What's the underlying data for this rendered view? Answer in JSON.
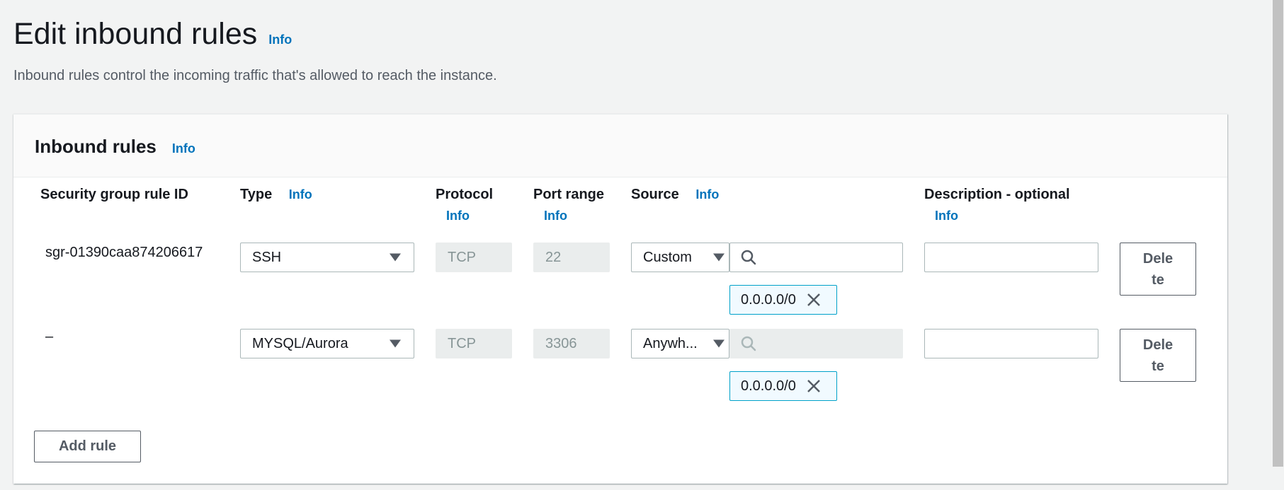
{
  "page": {
    "title": "Edit inbound rules",
    "title_info": "Info",
    "description": "Inbound rules control the incoming traffic that's allowed to reach the instance."
  },
  "panel": {
    "title": "Inbound rules",
    "title_info": "Info",
    "columns": {
      "rule_id": "Security group rule ID",
      "type": "Type",
      "type_info": "Info",
      "protocol": "Protocol",
      "protocol_info": "Info",
      "port_range": "Port range",
      "port_range_info": "Info",
      "source": "Source",
      "source_info": "Info",
      "description": "Description - optional",
      "description_info": "Info"
    },
    "rules": [
      {
        "rule_id": "sgr-01390caa874206617",
        "type": "SSH",
        "protocol": "TCP",
        "port_range": "22",
        "source_type": "Custom",
        "source_search": "",
        "source_search_disabled": false,
        "cidr_token": "0.0.0.0/0",
        "description": "",
        "delete_label": "Delete"
      },
      {
        "rule_id": "–",
        "type": "MYSQL/Aurora",
        "protocol": "TCP",
        "port_range": "3306",
        "source_type": "Anywh...",
        "source_search": "",
        "source_search_disabled": true,
        "cidr_token": "0.0.0.0/0",
        "description": "",
        "delete_label": "Delete"
      }
    ],
    "add_rule_label": "Add rule"
  },
  "colors": {
    "link": "#0073bb",
    "token_border": "#00a1c9",
    "token_bg": "#f1faff",
    "disabled_bg": "#eaeded"
  }
}
